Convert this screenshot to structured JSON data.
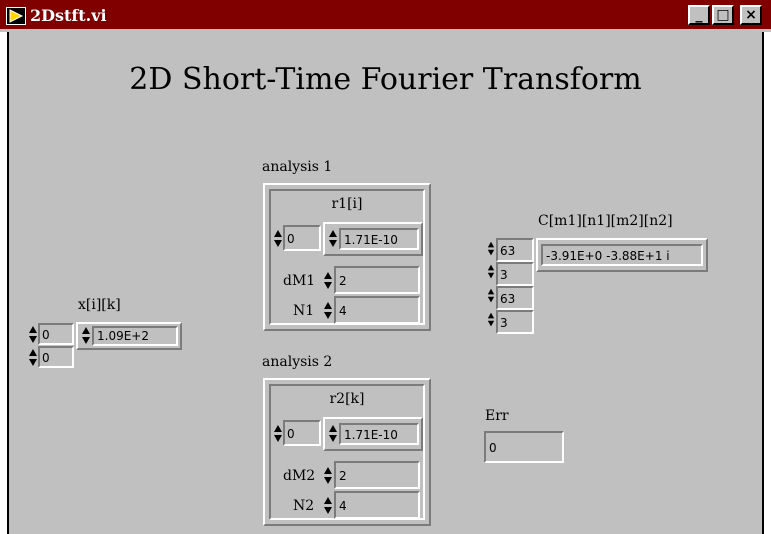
{
  "window": {
    "title": "2Dstft.vi",
    "minimize_label": "_",
    "maximize_label": "□",
    "close_label": "×"
  },
  "panel": {
    "title": "2D Short-Time Fourier Transform"
  },
  "x_control": {
    "label": "x[i][k]",
    "index_1": "0",
    "index_2": "0",
    "value": "1.09E+2"
  },
  "analysis1": {
    "label": "analysis 1",
    "array_label": "r1[i]",
    "array_index": "0",
    "array_value": "1.71E-10",
    "d_label": "dM1",
    "d_value": "2",
    "n_label": "N1",
    "n_value": "4"
  },
  "analysis2": {
    "label": "analysis 2",
    "array_label": "r2[k]",
    "array_index": "0",
    "array_value": "1.71E-10",
    "d_label": "dM2",
    "d_value": "2",
    "n_label": "N2",
    "n_value": "4"
  },
  "c_indicator": {
    "label": "C[m1][n1][m2][n2]",
    "index_1": "63",
    "index_2": "3",
    "index_3": "63",
    "index_4": "3",
    "value": "-3.91E+0 -3.88E+1 i"
  },
  "err_indicator": {
    "label": "Err",
    "value": "0"
  },
  "colors": {
    "title_bar": "#800000",
    "panel_background": "#c0c0c0"
  }
}
